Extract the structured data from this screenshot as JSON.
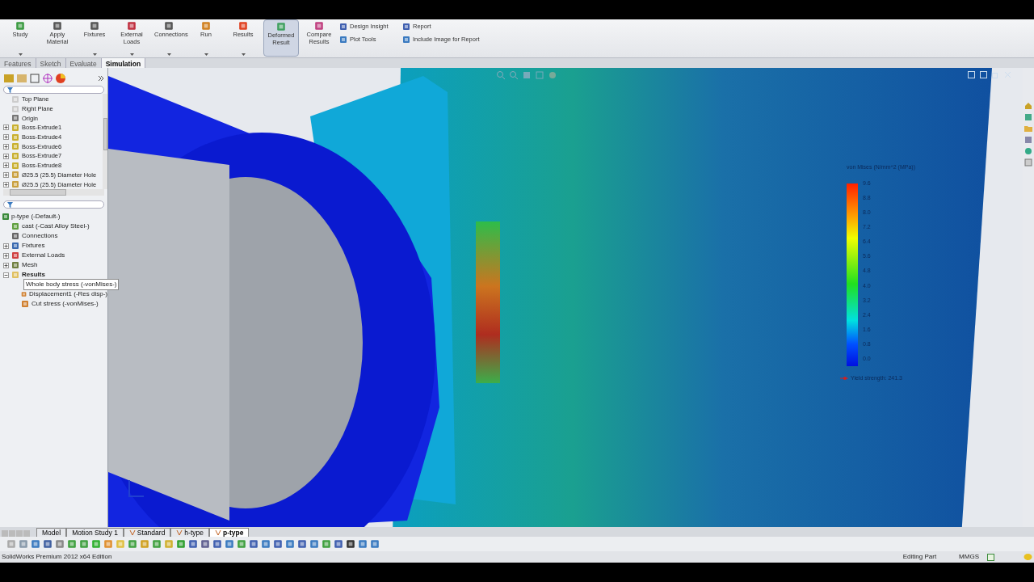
{
  "command_manager": {
    "buttons": [
      {
        "label": "Study",
        "dropdown": true,
        "selected": false
      },
      {
        "label": "Apply Material",
        "dropdown": false,
        "selected": false
      },
      {
        "label": "Fixtures",
        "dropdown": true,
        "selected": false
      },
      {
        "label": "External Loads",
        "dropdown": true,
        "selected": false
      },
      {
        "label": "Connections",
        "dropdown": true,
        "selected": false
      },
      {
        "label": "Run",
        "dropdown": true,
        "selected": false
      },
      {
        "label": "Results",
        "dropdown": true,
        "selected": false
      },
      {
        "label": "Deformed Result",
        "dropdown": false,
        "selected": true
      },
      {
        "label": "Compare Results",
        "dropdown": false,
        "selected": false
      }
    ],
    "small_buttons": [
      {
        "label": "Design Insight"
      },
      {
        "label": "Plot Tools"
      }
    ],
    "report_buttons": [
      {
        "label": "Report"
      },
      {
        "label": "Include Image for Report"
      }
    ]
  },
  "tabs": [
    {
      "label": "Features",
      "selected": false
    },
    {
      "label": "Sketch",
      "selected": false
    },
    {
      "label": "Evaluate",
      "selected": false
    },
    {
      "label": "Simulation",
      "selected": true
    }
  ],
  "feature_tree": [
    {
      "label": "Top Plane",
      "kind": "plane",
      "expandable": false
    },
    {
      "label": "Right Plane",
      "kind": "plane",
      "expandable": false
    },
    {
      "label": "Origin",
      "kind": "origin",
      "expandable": false
    },
    {
      "label": "Boss-Extrude1",
      "kind": "extrude",
      "expandable": true
    },
    {
      "label": "Boss-Extrude4",
      "kind": "extrude",
      "expandable": true
    },
    {
      "label": "Boss-Extrude6",
      "kind": "extrude",
      "expandable": true
    },
    {
      "label": "Boss-Extrude7",
      "kind": "extrude",
      "expandable": true
    },
    {
      "label": "Boss-Extrude8",
      "kind": "extrude",
      "expandable": true
    },
    {
      "label": "Ø25.5 (25.5) Diameter Hole",
      "kind": "hole",
      "expandable": true
    },
    {
      "label": "Ø25.5 (25.5) Diameter Hole",
      "kind": "hole",
      "expandable": true
    }
  ],
  "study_tree": {
    "label": "p-type (-Default-)",
    "children": [
      {
        "label": "cast (-Cast Alloy Steel-)",
        "kind": "material",
        "expandable": false,
        "expanded": false
      },
      {
        "label": "Connections",
        "kind": "connections",
        "expandable": false,
        "expanded": false
      },
      {
        "label": "Fixtures",
        "kind": "fixtures",
        "expandable": true,
        "expanded": false
      },
      {
        "label": "External Loads",
        "kind": "loads",
        "expandable": true,
        "expanded": false
      },
      {
        "label": "Mesh",
        "kind": "mesh",
        "expandable": true,
        "expanded": false
      },
      {
        "label": "Results",
        "kind": "folder",
        "expandable": true,
        "expanded": true,
        "children": [
          {
            "label": "Whole body stress (-vonMises-)",
            "selected": true
          },
          {
            "label": "Displacement1 (-Res disp-)",
            "selected": false
          },
          {
            "label": "Cut stress (-vonMises-)",
            "selected": false
          }
        ]
      }
    ]
  },
  "legend": {
    "title": "von Mises (N/mm^2 (MPa))",
    "ticks": [
      "9.6",
      "8.8",
      "8.0",
      "7.2",
      "6.4",
      "5.6",
      "4.8",
      "4.0",
      "3.2",
      "2.4",
      "1.6",
      "0.8",
      "0.0"
    ],
    "yield": "Yield strength: 241.3"
  },
  "bottom_tabs": [
    {
      "label": "Model",
      "selected": false,
      "study": false
    },
    {
      "label": "Motion Study 1",
      "selected": false,
      "study": false
    },
    {
      "label": "Standard",
      "selected": false,
      "study": true
    },
    {
      "label": "h-type",
      "selected": false,
      "study": true
    },
    {
      "label": "p-type",
      "selected": true,
      "study": true
    }
  ],
  "status_bar": {
    "edition": "SolidWorks Premium 2012 x64 Edition",
    "mode": "Editing Part",
    "units": "MMGS"
  }
}
